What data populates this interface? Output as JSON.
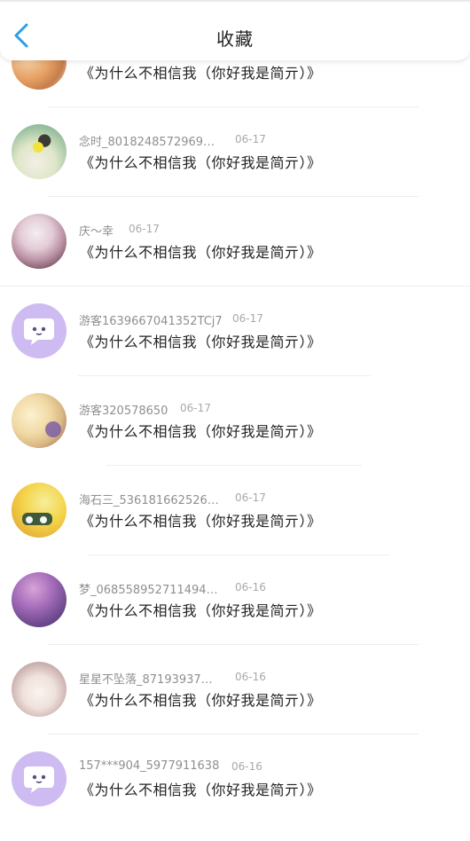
{
  "header": {
    "title": "收藏"
  },
  "items": [
    {
      "user": "",
      "date": "",
      "book": "《为什么不相信我（你好我是简亓）》"
    },
    {
      "user": "念时_8018248572969…",
      "date": "06-17",
      "book": "《为什么不相信我（你好我是简亓）》"
    },
    {
      "user": "庆～幸",
      "date": "06-17",
      "book": "《为什么不相信我（你好我是简亓）》"
    },
    {
      "user": "游客1639667041352TCj7",
      "date": "06-17",
      "book": "《为什么不相信我（你好我是简亓）》"
    },
    {
      "user": "游客320578650",
      "date": "06-17",
      "book": "《为什么不相信我（你好我是简亓）》"
    },
    {
      "user": "海石三_536181662526…",
      "date": "06-17",
      "book": "《为什么不相信我（你好我是简亓）》"
    },
    {
      "user": "梦_068558952711494…",
      "date": "06-16",
      "book": "《为什么不相信我（你好我是简亓）》"
    },
    {
      "user": "星星不坠落_87193937…",
      "date": "06-16",
      "book": "《为什么不相信我（你好我是简亓）》"
    },
    {
      "user": "157***904_5977911638",
      "date": "06-16",
      "book": "《为什么不相信我（你好我是简亓）》"
    }
  ],
  "colors": {
    "accent": "#2a9fe6",
    "default_avatar": "#cdbbf2"
  },
  "icons": {
    "back": "chevron-left-icon",
    "default_avatar": "chat-bubble-icon"
  }
}
